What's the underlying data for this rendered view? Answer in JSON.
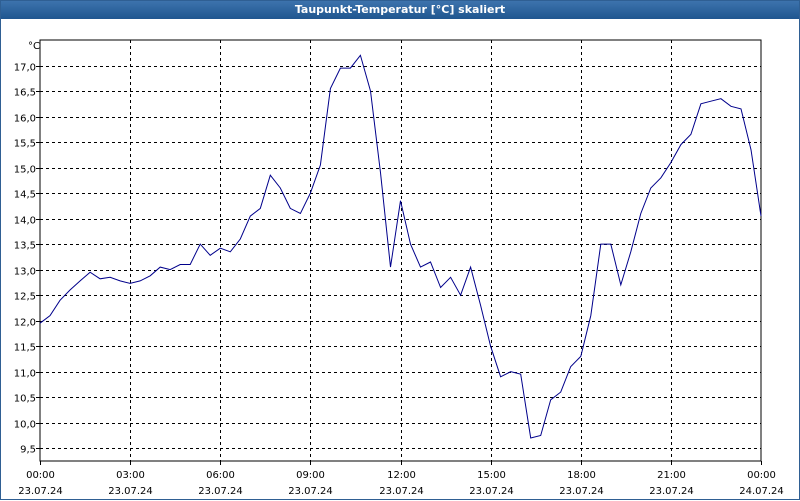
{
  "colors": {
    "titlebar": "#2a62a0",
    "line": "#00008b",
    "grid": "#000000"
  },
  "chart_data": {
    "type": "line",
    "title": "Taupunkt-Temperatur [°C] skaliert",
    "ylabel": "°C",
    "ylim": [
      9.25,
      17.5
    ],
    "yticks": [
      9.5,
      10.0,
      10.5,
      11.0,
      11.5,
      12.0,
      12.5,
      13.0,
      13.5,
      14.0,
      14.5,
      15.0,
      15.5,
      16.0,
      16.5,
      17.0
    ],
    "ytick_labels": [
      "9,5",
      "10,0",
      "10,5",
      "11,0",
      "11,5",
      "12,0",
      "12,5",
      "13,0",
      "13,5",
      "14,0",
      "14,5",
      "15,0",
      "15,5",
      "16,0",
      "16,5",
      "17,0"
    ],
    "xlim": [
      "2024-07-23 00:00",
      "2024-07-24 00:00"
    ],
    "xtick_times": [
      "00:00",
      "03:00",
      "06:00",
      "09:00",
      "12:00",
      "15:00",
      "18:00",
      "21:00",
      "00:00"
    ],
    "xtick_dates": [
      "23.07.24",
      "23.07.24",
      "23.07.24",
      "23.07.24",
      "23.07.24",
      "23.07.24",
      "23.07.24",
      "23.07.24",
      "24.07.24"
    ],
    "grid": true,
    "series": [
      {
        "x": [
          "00:00",
          "00:20",
          "00:40",
          "01:00",
          "01:20",
          "01:40",
          "02:00",
          "02:20",
          "02:40",
          "03:00",
          "03:20",
          "03:40",
          "04:00",
          "04:20",
          "04:40",
          "05:00",
          "05:20",
          "05:40",
          "06:00",
          "06:20",
          "06:40",
          "07:00",
          "07:20",
          "07:40",
          "08:00",
          "08:20",
          "08:40",
          "09:00",
          "09:20",
          "09:40",
          "10:00",
          "10:20",
          "10:40",
          "11:00",
          "11:20",
          "11:40",
          "12:00",
          "12:20",
          "12:40",
          "13:00",
          "13:20",
          "13:40",
          "14:00",
          "14:20",
          "14:40",
          "15:00",
          "15:20",
          "15:40",
          "16:00",
          "16:20",
          "16:40",
          "17:00",
          "17:20",
          "17:40",
          "18:00",
          "18:20",
          "18:40",
          "19:00",
          "19:20",
          "19:40",
          "20:00",
          "20:20",
          "20:40",
          "21:00",
          "21:20",
          "21:40",
          "22:00",
          "22:20",
          "22:40",
          "23:00",
          "23:20",
          "23:40",
          "24:00"
        ],
        "y": [
          11.95,
          12.1,
          12.4,
          12.6,
          12.78,
          12.95,
          12.82,
          12.85,
          12.78,
          12.73,
          12.78,
          12.88,
          13.05,
          13.0,
          13.1,
          13.1,
          13.5,
          13.28,
          13.42,
          13.35,
          13.6,
          14.05,
          14.2,
          14.85,
          14.6,
          14.2,
          14.1,
          14.5,
          15.05,
          16.55,
          16.95,
          16.95,
          17.2,
          16.5,
          14.9,
          13.05,
          14.35,
          13.5,
          13.05,
          13.15,
          12.65,
          12.85,
          12.5,
          13.05,
          12.3,
          11.5,
          10.9,
          11.0,
          10.95,
          9.7,
          9.75,
          10.45,
          10.6,
          11.1,
          11.3,
          12.1,
          13.5,
          13.5,
          12.7,
          13.35,
          14.1,
          14.6,
          14.8,
          15.1,
          15.45,
          15.65,
          16.25,
          16.3,
          16.35,
          16.2,
          16.15,
          15.35,
          14.05
        ]
      }
    ]
  }
}
